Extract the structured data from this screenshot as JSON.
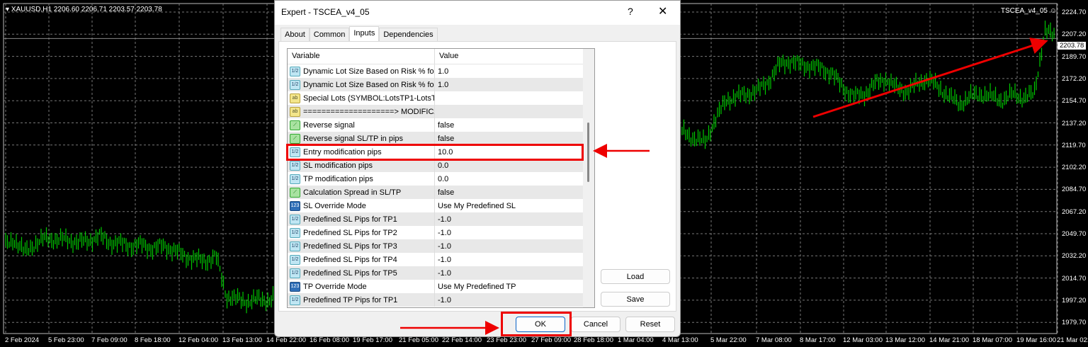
{
  "chart": {
    "symbol_line": "XAUUSD,H1  2206.60 2206.71 2203.57 2203.78",
    "ea_label": "TSCEA_v4_05",
    "current_price": "2203.78",
    "price_labels": [
      "2224.70",
      "2207.20",
      "2189.70",
      "2172.20",
      "2154.70",
      "2137.20",
      "2119.70",
      "2102.20",
      "2084.70",
      "2067.20",
      "2049.70",
      "2032.20",
      "2014.70",
      "1997.20",
      "1979.70"
    ],
    "time_labels": [
      "2 Feb 2024",
      "5 Feb 23:00",
      "7 Feb 09:00",
      "8 Feb 18:00",
      "12 Feb 04:00",
      "13 Feb 13:00",
      "14 Feb 22:00",
      "16 Feb 08:00",
      "19 Feb 17:00",
      "21 Feb 05:00",
      "22 Feb 14:00",
      "23 Feb 23:00",
      "27 Feb 09:00",
      "28 Feb 18:00",
      "1 Mar 04:00",
      "4 Mar 13:00",
      "5 Mar 22:00",
      "7 Mar 08:00",
      "8 Mar 17:00",
      "12 Mar 03:00",
      "13 Mar 12:00",
      "14 Mar 21:00",
      "18 Mar 07:00",
      "19 Mar 16:00",
      "21 Mar 02:00"
    ],
    "bar_color": "#00c800"
  },
  "chart_data": {
    "type": "line",
    "ylim": [
      1979.7,
      2224.7
    ],
    "grid": true,
    "values": [
      2040,
      2045,
      2035,
      2042,
      2046,
      2045,
      2045,
      2043,
      2044,
      2048,
      2043,
      2042,
      2040,
      2041,
      2038,
      2040,
      2037,
      2032,
      2030,
      2028,
      2032,
      2000,
      1998,
      1996,
      1998,
      1997,
      2002,
      2008,
      2012,
      2018,
      2025,
      2030,
      2035,
      2032,
      2040,
      2045,
      2050,
      2048,
      2055,
      2060,
      2065,
      2062,
      2070,
      2075,
      2080,
      2078,
      2085,
      2090,
      2095,
      2092,
      2100,
      2105,
      2110,
      2108,
      2112,
      2115,
      2118,
      2120,
      2122,
      2125,
      2128,
      2125,
      2130,
      2128,
      2130,
      2125,
      2122,
      2140,
      2155,
      2158,
      2160,
      2163,
      2170,
      2183,
      2186,
      2183,
      2182,
      2180,
      2176,
      2165,
      2158,
      2160,
      2168,
      2172,
      2165,
      2162,
      2168,
      2172,
      2165,
      2158,
      2152,
      2158,
      2160,
      2158,
      2155,
      2160,
      2157,
      2160,
      2210,
      2205
    ]
  },
  "dialog": {
    "title": "Expert - TSCEA_v4_05",
    "help": "?",
    "close": "✕",
    "tabs": [
      "About",
      "Common",
      "Inputs",
      "Dependencies"
    ],
    "active_tab": "Inputs",
    "columns": [
      "Variable",
      "Value"
    ],
    "rows": [
      {
        "type": "double",
        "icon": "1/2",
        "name": "Dynamic Lot Size Based on Risk % for ...",
        "value": "1.0"
      },
      {
        "type": "double",
        "icon": "1/2",
        "name": "Dynamic Lot Size Based on Risk % for ...",
        "value": "1.0"
      },
      {
        "type": "string",
        "icon": "ab",
        "name": "Special Lots (SYMBOL:LotsTP1-LotsT...",
        "value": ""
      },
      {
        "type": "string",
        "icon": "ab",
        "name": "====================> MODIFICA...",
        "value": ""
      },
      {
        "type": "bool",
        "icon": "⟋",
        "name": "Reverse signal",
        "value": "false"
      },
      {
        "type": "bool",
        "icon": "⟋",
        "name": "Reverse signal SL/TP in pips",
        "value": "false"
      },
      {
        "type": "double",
        "icon": "1/2",
        "name": "Entry modification pips",
        "value": "10.0"
      },
      {
        "type": "double",
        "icon": "1/2",
        "name": "SL modification pips",
        "value": "0.0"
      },
      {
        "type": "double",
        "icon": "1/2",
        "name": "TP modification pips",
        "value": "0.0"
      },
      {
        "type": "bool",
        "icon": "⟋",
        "name": "Calculation Spread in SL/TP",
        "value": "false"
      },
      {
        "type": "enum",
        "icon": "123",
        "name": "SL Override Mode",
        "value": "Use My Predefined SL"
      },
      {
        "type": "double",
        "icon": "1/2",
        "name": "Predefined SL Pips for TP1",
        "value": "-1.0"
      },
      {
        "type": "double",
        "icon": "1/2",
        "name": "Predefined SL Pips for TP2",
        "value": "-1.0"
      },
      {
        "type": "double",
        "icon": "1/2",
        "name": "Predefined SL Pips for TP3",
        "value": "-1.0"
      },
      {
        "type": "double",
        "icon": "1/2",
        "name": "Predefined SL Pips for TP4",
        "value": "-1.0"
      },
      {
        "type": "double",
        "icon": "1/2",
        "name": "Predefined SL Pips for TP5",
        "value": "-1.0"
      },
      {
        "type": "enum",
        "icon": "123",
        "name": "TP Override Mode",
        "value": "Use My Predefined TP"
      },
      {
        "type": "double",
        "icon": "1/2",
        "name": "Predefined TP Pips for TP1",
        "value": "-1.0"
      }
    ],
    "highlighted_row": "Entry modification pips",
    "load": "Load",
    "save": "Save",
    "ok": "OK",
    "cancel": "Cancel",
    "reset": "Reset"
  },
  "annotation_color": "#e00000"
}
